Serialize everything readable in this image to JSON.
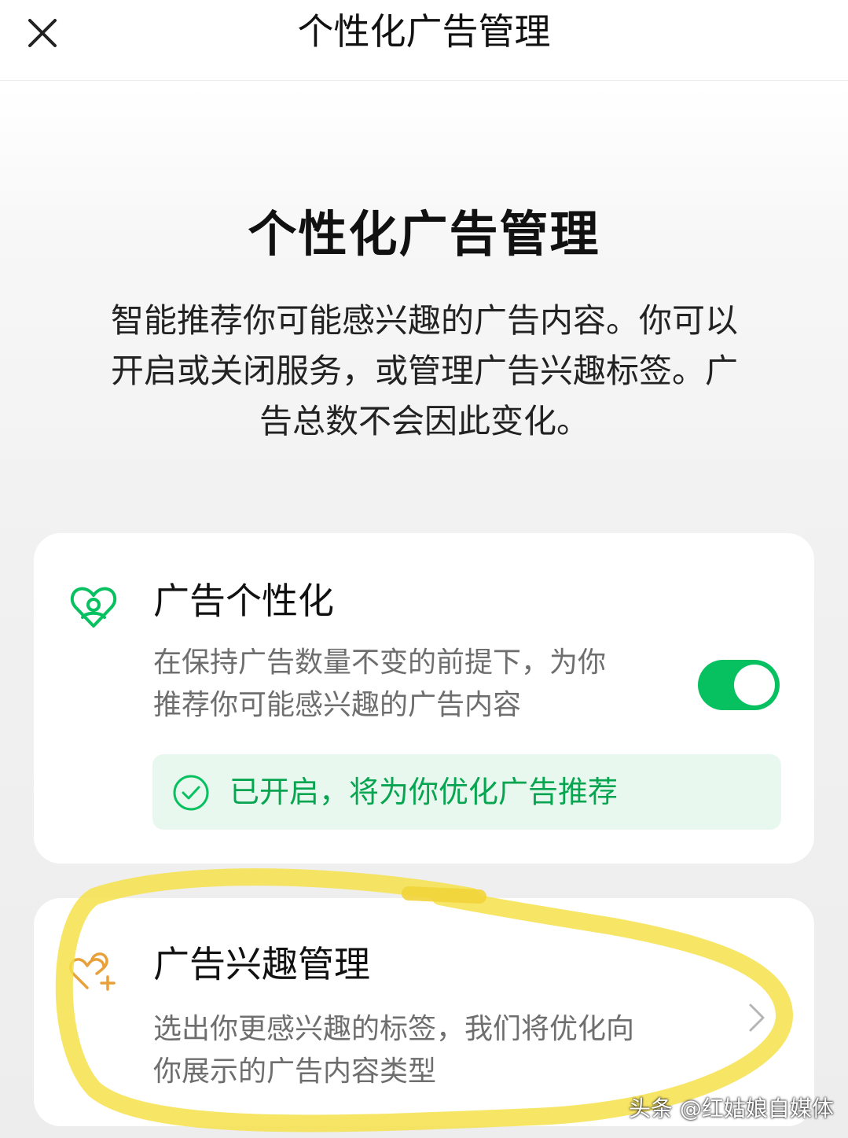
{
  "header": {
    "title": "个性化广告管理",
    "close_icon": "close-icon"
  },
  "hero": {
    "title": "个性化广告管理",
    "description_lines": [
      "智能推荐你可能感兴趣的广告内容。你可以",
      "开启或关闭服务，或管理广告兴趣标签。广",
      "告总数不会因此变化。"
    ]
  },
  "personalization_card": {
    "icon": "heart-person-icon",
    "title": "广告个性化",
    "description_lines": [
      "在保持广告数量不变的前提下，为你",
      "推荐你可能感兴趣的广告内容"
    ],
    "toggle_on": true,
    "status": {
      "icon": "check-circle-icon",
      "text": "已开启，将为你优化广告推荐"
    }
  },
  "interest_card": {
    "icon": "hearts-plus-icon",
    "title": "广告兴趣管理",
    "description_lines": [
      "选出你更感兴趣的标签，我们将优化向",
      "你展示的广告内容类型"
    ],
    "chevron_icon": "chevron-right-icon"
  },
  "watermark": "头条 @红姑娘自媒体",
  "colors": {
    "accent_green": "#07c160",
    "status_bg": "#e8f8ee",
    "orange_icon": "#e8a13a",
    "highlight_yellow": "#f6e04a"
  }
}
